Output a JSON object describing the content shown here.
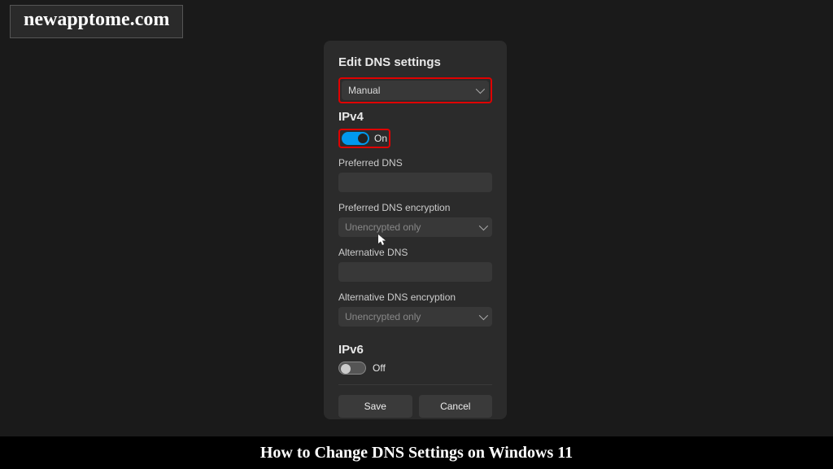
{
  "watermark": "newapptome.com",
  "dialog": {
    "title": "Edit DNS settings",
    "mode_dropdown": {
      "selected": "Manual"
    },
    "ipv4": {
      "label": "IPv4",
      "toggle_state": "On",
      "preferred_dns_label": "Preferred DNS",
      "preferred_dns_value": "",
      "preferred_enc_label": "Preferred DNS encryption",
      "preferred_enc_value": "Unencrypted only",
      "alt_dns_label": "Alternative DNS",
      "alt_dns_value": "",
      "alt_enc_label": "Alternative DNS encryption",
      "alt_enc_value": "Unencrypted only"
    },
    "ipv6": {
      "label": "IPv6",
      "toggle_state": "Off"
    },
    "save_label": "Save",
    "cancel_label": "Cancel"
  },
  "footer": "How to Change DNS Settings on Windows 11"
}
